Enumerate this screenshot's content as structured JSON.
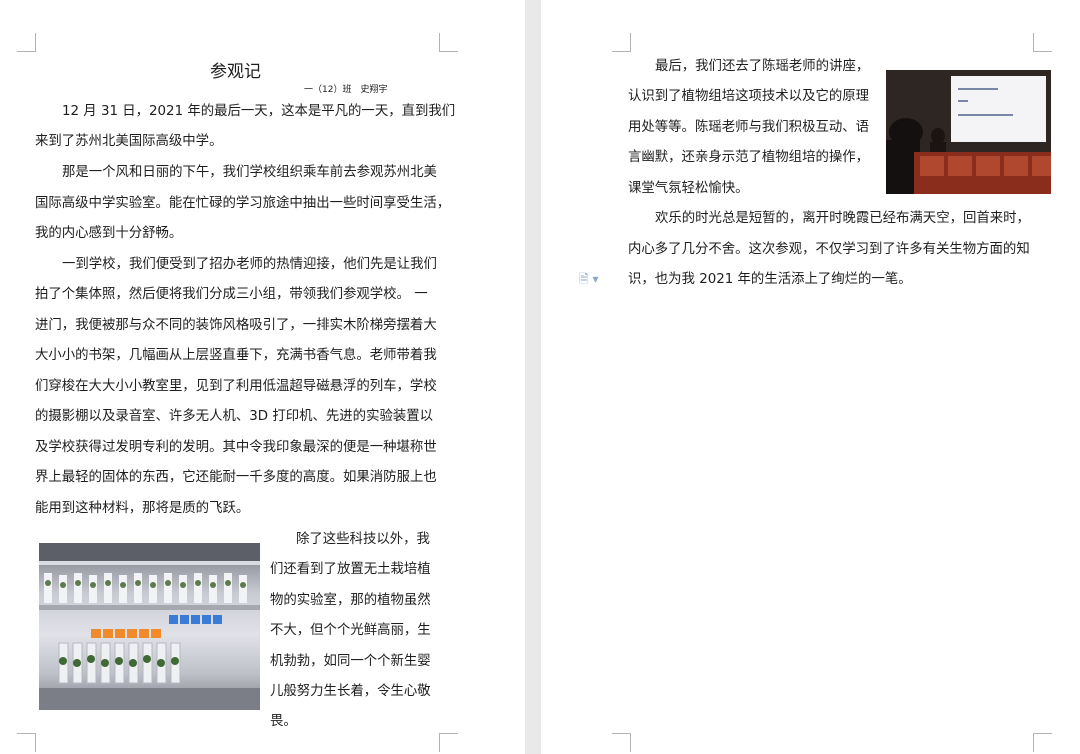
{
  "page1": {
    "title": "参观记",
    "byline": "一（12）班　史翔宇",
    "lines": [
      "12 月 31 日，2021 年的最后一天，这本是平凡的一天，直到我们",
      "来到了苏州北美国际高级中学。",
      "那是一个风和日丽的下午，我们学校组织乘车前去参观苏州北美",
      "国际高级中学实验室。能在忙碌的学习旅途中抽出一些时间享受生活，",
      "我的内心感到十分舒畅。",
      "一到学校，我们便受到了招办老师的热情迎接，他们先是让我们",
      "拍了个集体照，然后便将我们分成三小组，带领我们参观学校。 一",
      "进门，我便被那与众不同的装饰风格吸引了，一排实木阶梯旁摆着大",
      "大小小的书架，几幅画从上层竖直垂下，充满书香气息。老师带着我",
      "们穿梭在大大小小教室里，见到了利用低温超导磁悬浮的列车，学校",
      "的摄影棚以及录音室、许多无人机、3D 打印机、先进的实验装置以",
      "及学校获得过发明专利的发明。其中令我印象最深的便是一种堪称世",
      "界上最轻的固体的东西，它还能耐一千多度的高度。如果消防服上也",
      "能用到这种材料，那将是质的飞跃。"
    ],
    "float_lines": [
      "除了这些科技以外，我",
      "们还看到了放置无土栽培植",
      "物的实验室，那的植物虽然",
      "不大，但个个光鲜高丽，生",
      "机勃勃，如同一个个新生婴",
      "儿般努力生长着，令生心敬",
      "畏。"
    ]
  },
  "page2": {
    "lines": [
      "最后，我们还去了陈瑶老师的讲座，",
      "认识到了植物组培这项技术以及它的原理",
      "用处等等。陈瑶老师与我们积极互动、语",
      "言幽默，还亲身示范了植物组培的操作，",
      "课堂气氛轻松愉快。",
      "欢乐的时光总是短暂的，离开时晚霞已经布满天空，回首来时，",
      "内心多了几分不舍。这次参观，不仅学习到了许多有关生物方面的知",
      "识，也为我 2021 年的生活添上了绚烂的一笔。"
    ]
  },
  "icons": {
    "doc": "document-icon"
  }
}
